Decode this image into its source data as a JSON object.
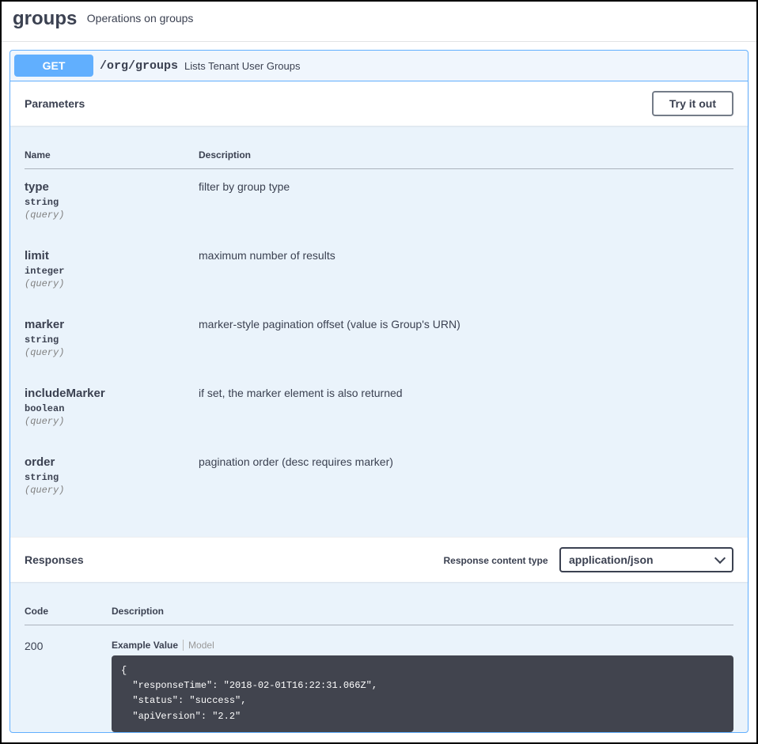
{
  "tag": {
    "name": "groups",
    "description": "Operations on groups"
  },
  "operation": {
    "method": "GET",
    "path": "/org/groups",
    "summary": "Lists Tenant User Groups",
    "try_label": "Try it out"
  },
  "parameters": {
    "heading": "Parameters",
    "columns": {
      "name": "Name",
      "description": "Description"
    },
    "items": [
      {
        "name": "type",
        "type": "string",
        "in": "(query)",
        "description": "filter by group type"
      },
      {
        "name": "limit",
        "type": "integer",
        "in": "(query)",
        "description": "maximum number of results"
      },
      {
        "name": "marker",
        "type": "string",
        "in": "(query)",
        "description": "marker-style pagination offset (value is Group's URN)"
      },
      {
        "name": "includeMarker",
        "type": "boolean",
        "in": "(query)",
        "description": "if set, the marker element is also returned"
      },
      {
        "name": "order",
        "type": "string",
        "in": "(query)",
        "description": "pagination order (desc requires marker)"
      }
    ]
  },
  "responses": {
    "heading": "Responses",
    "content_type_label": "Response content type",
    "content_type_value": "application/json",
    "columns": {
      "code": "Code",
      "description": "Description"
    },
    "items": [
      {
        "code": "200",
        "tabs": {
          "example": "Example Value",
          "model": "Model"
        },
        "example_lines": [
          "{",
          "  \"responseTime\": \"2018-02-01T16:22:31.066Z\",",
          "  \"status\": \"success\",",
          "  \"apiVersion\": \"2.2\""
        ]
      }
    ]
  }
}
